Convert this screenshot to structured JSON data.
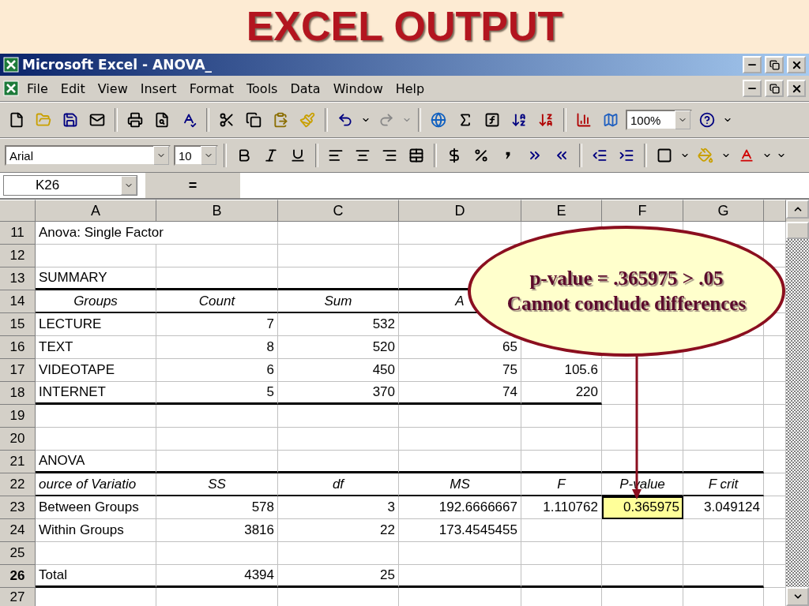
{
  "slide_title": "EXCEL OUTPUT",
  "window": {
    "title": "Microsoft Excel - ANOVA_"
  },
  "menu": [
    "File",
    "Edit",
    "View",
    "Insert",
    "Format",
    "Tools",
    "Data",
    "Window",
    "Help"
  ],
  "zoom_field": {
    "value": "100%"
  },
  "font_field": {
    "value": "Arial"
  },
  "size_field": {
    "value": "10"
  },
  "formula_bar": {
    "name_box": "K26",
    "equals": "="
  },
  "sheet": {
    "columns": [
      "A",
      "B",
      "C",
      "D",
      "E",
      "F",
      "G"
    ],
    "rows": [
      {
        "number": "11",
        "selected": false,
        "cells": [
          {
            "kind": "label-wide",
            "text": "Anova: Single Factor"
          }
        ]
      },
      {
        "number": "12",
        "selected": false
      },
      {
        "number": "13",
        "selected": false,
        "cells": [
          {
            "kind": "label",
            "text": "SUMMARY"
          }
        ]
      },
      {
        "number": "14",
        "selected": false,
        "cells": [
          {
            "kind": "header",
            "text": "Groups"
          },
          {
            "kind": "header",
            "text": "Count"
          },
          {
            "kind": "header",
            "text": "Sum"
          },
          {
            "kind": "header",
            "text": "A"
          }
        ]
      },
      {
        "number": "15",
        "selected": false,
        "cells": [
          {
            "kind": "label",
            "text": "LECTURE"
          },
          {
            "kind": "number",
            "text": "7"
          },
          {
            "kind": "number",
            "text": "532"
          }
        ]
      },
      {
        "number": "16",
        "selected": false,
        "cells": [
          {
            "kind": "label",
            "text": "TEXT"
          },
          {
            "kind": "number",
            "text": "8"
          },
          {
            "kind": "number",
            "text": "520"
          },
          {
            "kind": "number",
            "text": "65"
          }
        ]
      },
      {
        "number": "17",
        "selected": false,
        "cells": [
          {
            "kind": "label",
            "text": "VIDEOTAPE"
          },
          {
            "kind": "number",
            "text": "6"
          },
          {
            "kind": "number",
            "text": "450"
          },
          {
            "kind": "number",
            "text": "75"
          },
          {
            "kind": "number",
            "text": "105.6"
          }
        ]
      },
      {
        "number": "18",
        "selected": false,
        "cells": [
          {
            "kind": "label",
            "text": "INTERNET"
          },
          {
            "kind": "number",
            "text": "5"
          },
          {
            "kind": "number",
            "text": "370"
          },
          {
            "kind": "number",
            "text": "74"
          },
          {
            "kind": "number",
            "text": "220"
          }
        ]
      },
      {
        "number": "19",
        "selected": false
      },
      {
        "number": "20",
        "selected": false
      },
      {
        "number": "21",
        "selected": false,
        "cells": [
          {
            "kind": "label",
            "text": "ANOVA"
          }
        ]
      },
      {
        "number": "22",
        "selected": false,
        "cells": [
          {
            "kind": "header-cut",
            "text": "ource of Variatio"
          },
          {
            "kind": "header",
            "text": "SS"
          },
          {
            "kind": "header",
            "text": "df"
          },
          {
            "kind": "header",
            "text": "MS"
          },
          {
            "kind": "header",
            "text": "F"
          },
          {
            "kind": "header",
            "text": "P-value"
          },
          {
            "kind": "header",
            "text": "F crit"
          }
        ]
      },
      {
        "number": "23",
        "selected": false,
        "cells": [
          {
            "kind": "label",
            "text": "Between Groups"
          },
          {
            "kind": "number",
            "text": "578"
          },
          {
            "kind": "number",
            "text": "3"
          },
          {
            "kind": "number",
            "text": "192.6666667"
          },
          {
            "kind": "number",
            "text": "1.110762"
          },
          {
            "kind": "highlight",
            "text": "0.365975"
          },
          {
            "kind": "number",
            "text": "3.049124"
          }
        ]
      },
      {
        "number": "24",
        "selected": false,
        "cells": [
          {
            "kind": "label",
            "text": "Within Groups"
          },
          {
            "kind": "number",
            "text": "3816"
          },
          {
            "kind": "number",
            "text": "22"
          },
          {
            "kind": "number",
            "text": "173.4545455"
          }
        ]
      },
      {
        "number": "25",
        "selected": false
      },
      {
        "number": "26",
        "selected": true,
        "cells": [
          {
            "kind": "label",
            "text": "Total"
          },
          {
            "kind": "number",
            "text": "4394"
          },
          {
            "kind": "number",
            "text": "25"
          }
        ]
      },
      {
        "number": "27",
        "selected": false
      }
    ]
  },
  "callout": {
    "lines": [
      "p-value = .365975 > .05",
      "Cannot conclude differences"
    ]
  }
}
